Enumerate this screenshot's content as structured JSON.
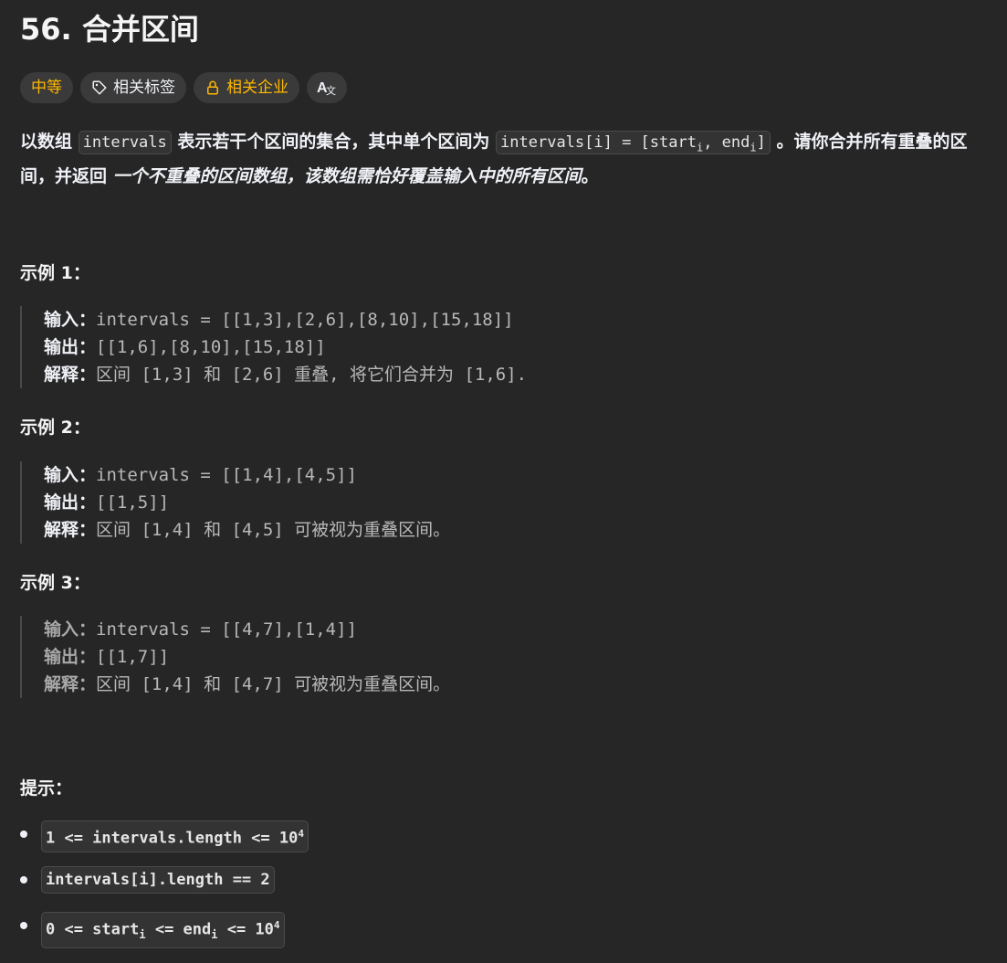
{
  "problem": {
    "title": "56. 合并区间"
  },
  "tags": {
    "difficulty": "中等",
    "topics": "相关标签",
    "companies": "相关企业",
    "translate": "Aあ"
  },
  "description": {
    "p1": "以数组",
    "code1": "intervals",
    "p2": "表示若干个区间的集合，其中单个区间为",
    "code2a": "intervals[i] = [start",
    "code2sub1": "i",
    "code2b": ", end",
    "code2sub2": "i",
    "code2c": "]",
    "p3": "。请你合并所有重叠的区间，并返回",
    "em": "一个不重叠的区间数组，该数组需恰好覆盖输入中的所有区间",
    "p4": "。"
  },
  "labels": {
    "input": "输入：",
    "output": "输出：",
    "explain": "解释："
  },
  "examples": [
    {
      "title": "示例 1：",
      "input": "intervals = [[1,3],[2,6],[8,10],[15,18]]",
      "output": "[[1,6],[8,10],[15,18]]",
      "explanation": "区间 [1,3] 和 [2,6] 重叠, 将它们合并为 [1,6]."
    },
    {
      "title": "示例 2：",
      "input": "intervals = [[1,4],[4,5]]",
      "output": "[[1,5]]",
      "explanation": "区间 [1,4] 和 [4,5] 可被视为重叠区间。"
    },
    {
      "title": "示例 3：",
      "input": "intervals = [[4,7],[1,4]]",
      "output": "[[1,7]]",
      "explanation": "区间 [1,4] 和 [4,7] 可被视为重叠区间。"
    }
  ],
  "hints": {
    "title": "提示：",
    "c1": "1 <= intervals.length <= 10",
    "c1sup": "4",
    "c2": "intervals[i].length == 2",
    "c3a": "0 <= start",
    "c3sub1": "i",
    "c3b": " <= end",
    "c3sub2": "i",
    "c3c": " <= 10",
    "c3sup": "4"
  }
}
